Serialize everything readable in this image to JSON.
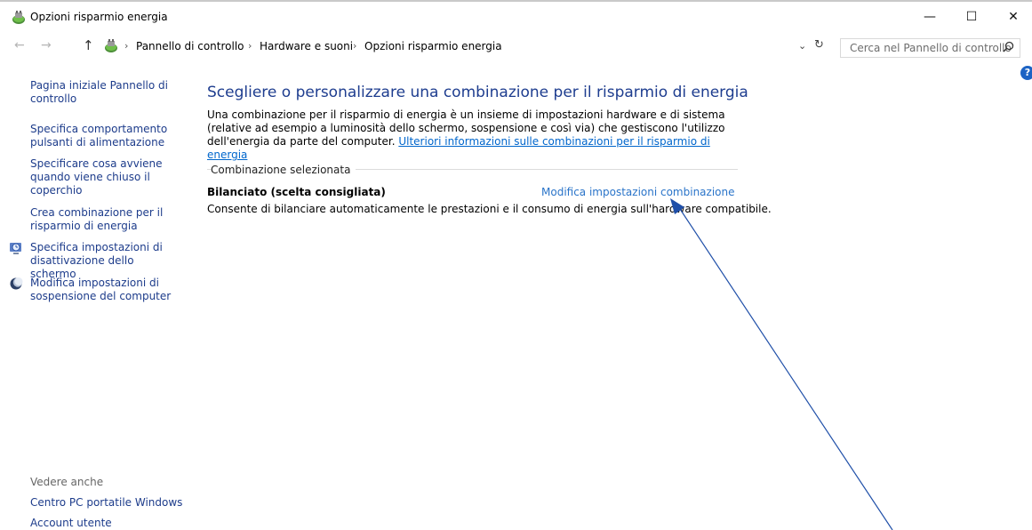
{
  "window": {
    "title": "Opzioni risparmio energia",
    "minimize": "—",
    "maximize": "☐",
    "close": "✕"
  },
  "address": {
    "back": "←",
    "forward": "→",
    "up": "↑",
    "separator": "›",
    "breadcrumbs": [
      "Pannello di controllo",
      "Hardware e suoni",
      "Opzioni risparmio energia"
    ],
    "dropdown": "⌄",
    "refresh": "↻",
    "search_placeholder": "Cerca nel Pannello di controllo"
  },
  "help": "?",
  "sidebar": {
    "items": [
      {
        "label": "Pagina iniziale Pannello di controllo"
      },
      {
        "label": "Specifica comportamento pulsanti di alimentazione"
      },
      {
        "label": "Specificare cosa avviene quando viene chiuso il coperchio"
      },
      {
        "label": "Crea combinazione per il risparmio di energia"
      },
      {
        "label": "Specifica impostazioni di disattivazione dello schermo",
        "icon": "screen-clock-icon"
      },
      {
        "label": "Modifica impostazioni di sospensione del computer",
        "icon": "moon-icon"
      }
    ],
    "see_also": "Vedere anche",
    "also_links": [
      "Centro PC portatile Windows",
      "Account utente"
    ]
  },
  "main": {
    "title": "Scegliere o personalizzare una combinazione per il risparmio di energia",
    "description": "Una combinazione per il risparmio di energia è un insieme di impostazioni hardware e di sistema (relative ad esempio a luminosità dello schermo, sospensione e così via) che gestiscono l'utilizzo dell'energia da parte del computer.",
    "more_info_link": "Ulteriori informazioni sulle combinazioni per il risparmio di energia",
    "section_label": "Combinazione selezionata",
    "plan": {
      "name": "Bilanciato (scelta consigliata)",
      "edit_link": "Modifica impostazioni combinazione",
      "description": "Consente di bilanciare automaticamente le prestazioni e il consumo di energia sull'hardware compatibile."
    }
  },
  "colors": {
    "link": "#1d3c8b",
    "title": "#1e3d8f",
    "accent_link": "#2a74c9",
    "annotation_arrow": "#1f4fa8"
  }
}
